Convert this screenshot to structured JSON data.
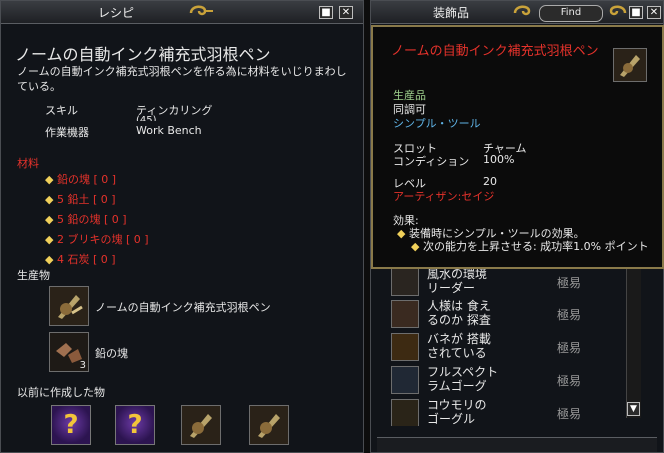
{
  "recipe_window": {
    "title": "レシピ",
    "item_name": "ノームの自動インク補充式羽根ペン",
    "description": "ノームの自動インク補充式羽根ペンを作る為に材料をいじりまわしている。",
    "skill_label": "スキル",
    "skill_value": "ティンカリング",
    "skill_value_cut": "(45)",
    "device_label": "作業機器",
    "device_value": "Work Bench",
    "materials_heading": "材料",
    "materials": [
      "鉛の塊 [ 0 ]",
      "5 鉛土 [ 0 ]",
      "5 鉛の塊 [ 0 ]",
      "2 ブリキの塊 [ 0 ]",
      "4 石炭 [ 0 ]"
    ],
    "products_heading": "生産物",
    "products": [
      {
        "name": "ノームの自動インク補充式羽根ペン",
        "icon": "quill-pen-icon",
        "count": ""
      },
      {
        "name": "鉛の塊",
        "icon": "ore-chunk-icon",
        "count": "3"
      }
    ],
    "previous_heading": "以前に作成した物",
    "previous_icons": [
      "question-icon",
      "question-icon",
      "quill-pen-icon",
      "quill-pen-icon"
    ]
  },
  "ornament_window": {
    "title": "装飾品",
    "find_label": "Find",
    "list": [
      {
        "name": "風水の環境リーダー",
        "line1": "風水の環境",
        "line2": "リーダー",
        "rating": "極易",
        "icon": "reader-icon"
      },
      {
        "name": "人様は食えるのか探査",
        "line1": "人様は 食え",
        "line2": "るのか 探査",
        "rating": "極易",
        "icon": "probe-icon"
      },
      {
        "name": "バネが搭載されている",
        "line1": "バネが 搭載",
        "line2": "されている",
        "rating": "極易",
        "icon": "boot-icon"
      },
      {
        "name": "フルスペクトラムゴーグ",
        "line1": "フルスペクト",
        "line2": "ラムゴーグ",
        "rating": "極易",
        "icon": "goggles-icon"
      },
      {
        "name": "コウモリのゴーグル",
        "line1": "コウモリの",
        "line2": "ゴーグル",
        "rating": "極易",
        "icon": "goggles-icon"
      }
    ]
  },
  "tooltip": {
    "title": "ノームの自動インク補充式羽根ペン",
    "tag1": "生産品",
    "tag2": "同調可",
    "tag3": "シンプル・ツール",
    "slot_label": "スロット",
    "slot_value": "チャーム",
    "condition_label": "コンディション",
    "condition_value": "100%",
    "level_label": "レベル",
    "level_value": "20",
    "artisan_label": "アーティザン:",
    "artisan_value": "セイジ",
    "effects_heading": "効果:",
    "effect1": "装備時にシンプル・ツールの効果。",
    "effect2": "次の能力を上昇させる: 成功率1.0% ポイント"
  },
  "colors": {
    "title_red": "#e5322b",
    "gold": "#f0d05a",
    "green": "#9ed08c",
    "cyan": "#5fb3e6"
  }
}
